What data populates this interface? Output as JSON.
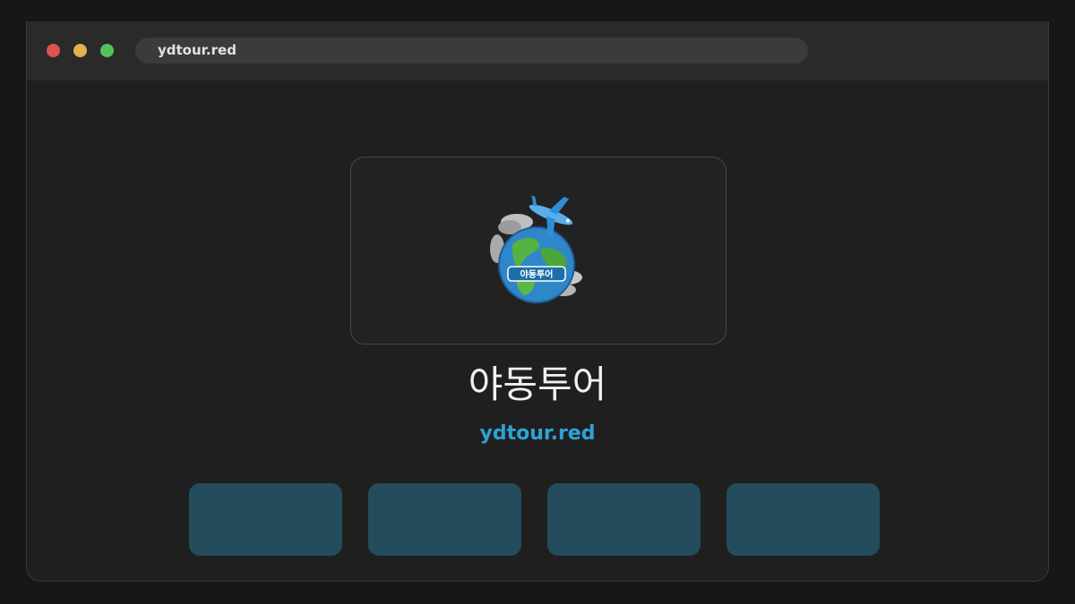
{
  "browser": {
    "url": "ydtour.red"
  },
  "logo": {
    "icon": "globe-airplane-icon",
    "text": "야동투어"
  },
  "site": {
    "title": "야동투어",
    "domain": "ydtour.red"
  },
  "colors": {
    "background": "#171717",
    "window": "#1f1f1f",
    "titlebar": "#2a2a2a",
    "accent": "#2ea3d6",
    "button": "#234d5d"
  }
}
